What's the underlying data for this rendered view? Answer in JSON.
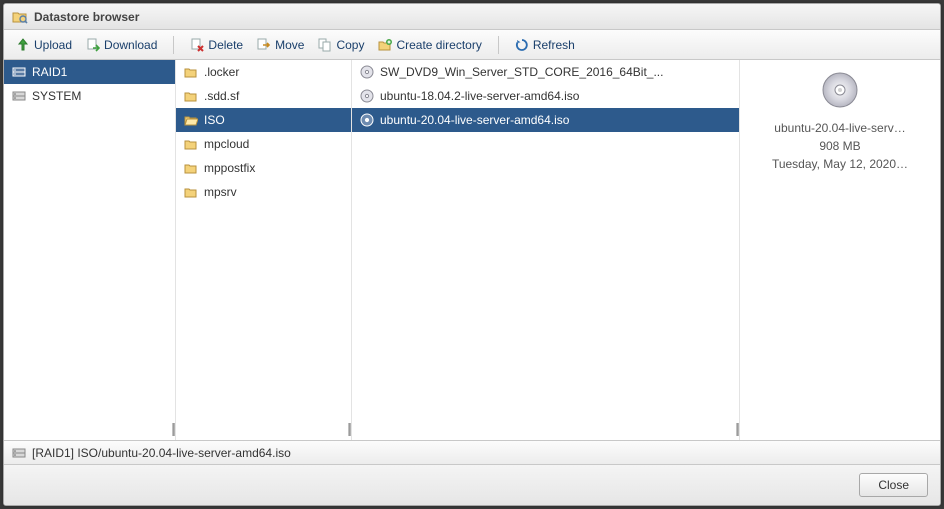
{
  "title": "Datastore browser",
  "toolbar": {
    "upload": "Upload",
    "download": "Download",
    "delete": "Delete",
    "move": "Move",
    "copy": "Copy",
    "create_dir": "Create directory",
    "refresh": "Refresh"
  },
  "datastores": [
    {
      "name": "RAID1",
      "selected": true
    },
    {
      "name": "SYSTEM",
      "selected": false
    }
  ],
  "folders": [
    {
      "name": ".locker",
      "selected": false
    },
    {
      "name": ".sdd.sf",
      "selected": false
    },
    {
      "name": "ISO",
      "selected": true
    },
    {
      "name": "mpcloud",
      "selected": false
    },
    {
      "name": "mppostfix",
      "selected": false
    },
    {
      "name": "mpsrv",
      "selected": false
    }
  ],
  "files": [
    {
      "name": "SW_DVD9_Win_Server_STD_CORE_2016_64Bit_...",
      "selected": false
    },
    {
      "name": "ubuntu-18.04.2-live-server-amd64.iso",
      "selected": false
    },
    {
      "name": "ubuntu-20.04-live-server-amd64.iso",
      "selected": true
    }
  ],
  "preview": {
    "name": "ubuntu-20.04-live-serv…",
    "size": "908 MB",
    "date": "Tuesday, May 12, 2020…"
  },
  "status_path": "[RAID1] ISO/ubuntu-20.04-live-server-amd64.iso",
  "close": "Close"
}
